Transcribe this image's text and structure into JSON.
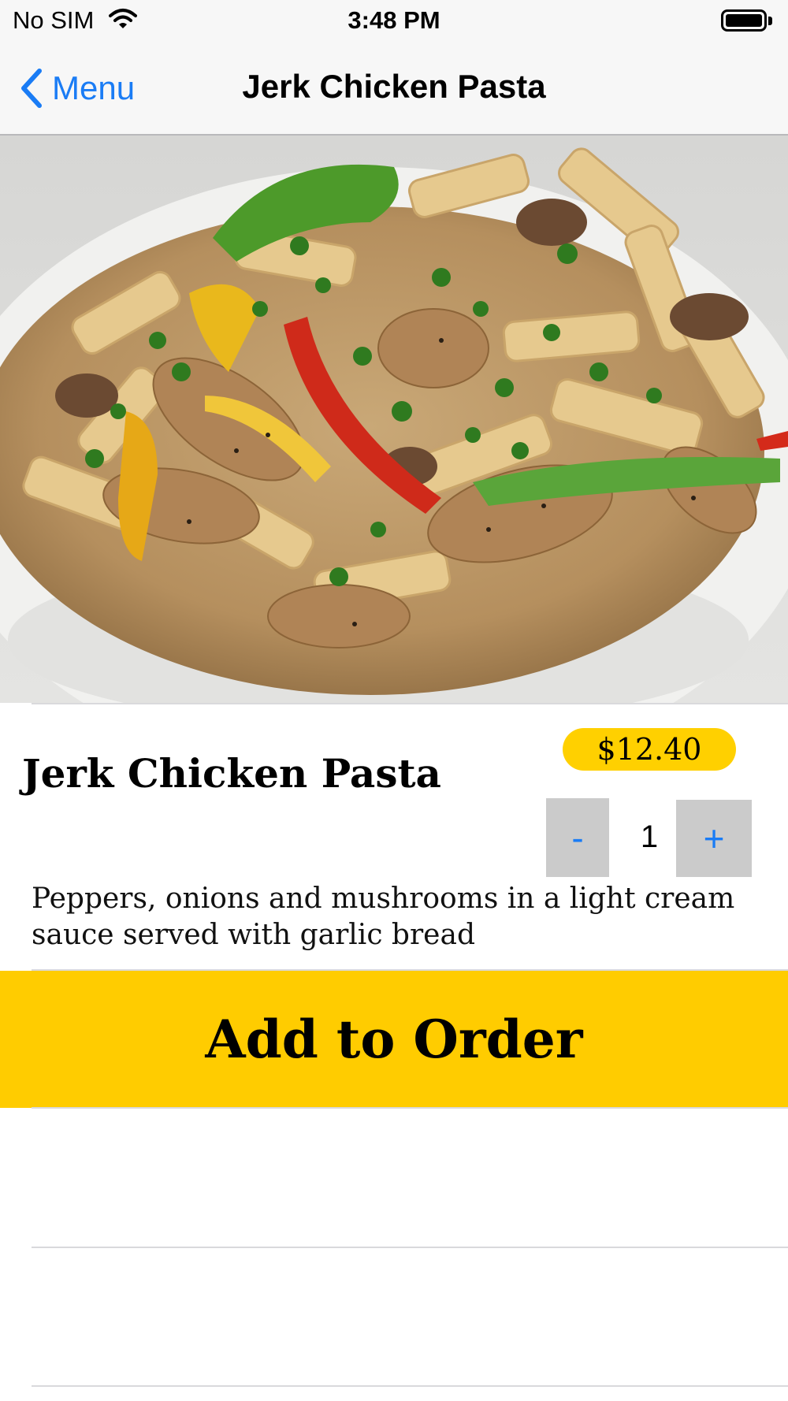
{
  "status_bar": {
    "carrier": "No SIM",
    "time": "3:48 PM"
  },
  "nav": {
    "back_label": "Menu",
    "title": "Jerk Chicken Pasta"
  },
  "dish": {
    "name": "Jerk Chicken Pasta",
    "price": "$12.40",
    "description": "Peppers, onions and mushrooms in a light cream sauce served with garlic bread",
    "image": "jerk chicken pasta in a white bowl"
  },
  "stepper": {
    "minus_label": "-",
    "quantity": "1",
    "plus_label": "+"
  },
  "actions": {
    "add_to_order": "Add to Order"
  },
  "colors": {
    "accent_yellow": "#ffcc00",
    "price_badge": "#ffd000",
    "ios_blue": "#1a7cf5",
    "stepper_bg": "#cbcbcb"
  }
}
